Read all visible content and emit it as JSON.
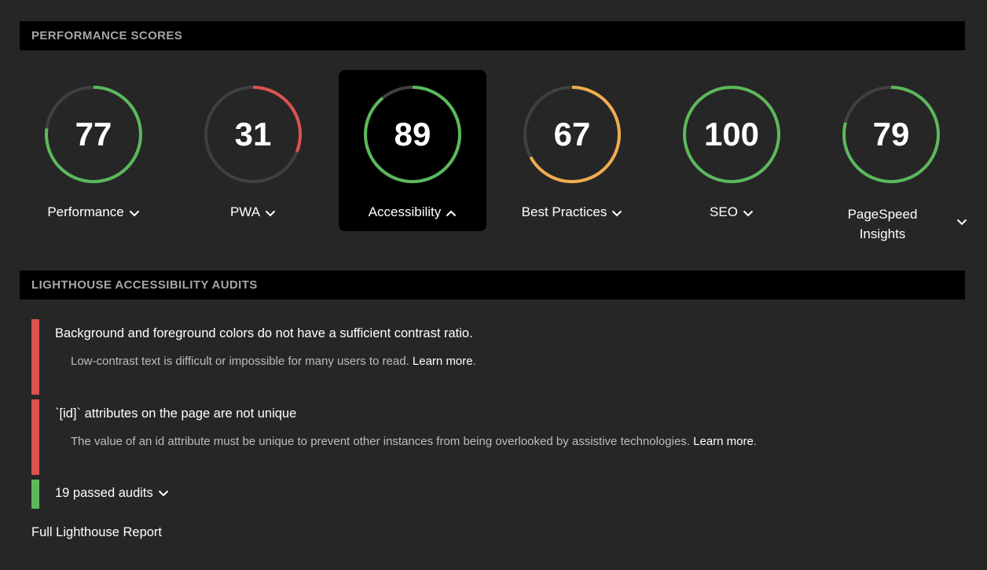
{
  "headers": {
    "scores": "PERFORMANCE SCORES",
    "audits": "LIGHTHOUSE ACCESSIBILITY AUDITS"
  },
  "colors": {
    "good": "#5cb85c",
    "average": "#f0ad4e",
    "poor": "#d9534f",
    "track": "#404040"
  },
  "scores": [
    {
      "label": "Performance",
      "value": "77",
      "score": 77,
      "status": "good",
      "chevron": "chevron-down-icon"
    },
    {
      "label": "PWA",
      "value": "31",
      "score": 31,
      "status": "poor",
      "chevron": "chevron-down-icon"
    },
    {
      "label": "Accessibility",
      "value": "89",
      "score": 89,
      "status": "good",
      "chevron": "chevron-up-icon",
      "active": true
    },
    {
      "label": "Best Practices",
      "value": "67",
      "score": 67,
      "status": "average",
      "chevron": "chevron-down-icon"
    },
    {
      "label": "SEO",
      "value": "100",
      "score": 100,
      "status": "good",
      "chevron": "chevron-down-icon"
    },
    {
      "label_line1": "PageSpeed",
      "label_line2": "Insights",
      "value": "79",
      "score": 79,
      "status": "good",
      "chevron": "chevron-down-icon"
    }
  ],
  "audits": [
    {
      "title": "Background and foreground colors do not have a sufficient contrast ratio.",
      "description": "Low-contrast text is difficult or impossible for many users to read.",
      "learn_more": "Learn more",
      "period": ".",
      "status": "poor"
    },
    {
      "title": "`[id]` attributes on the page are not unique",
      "description": "The value of an id attribute must be unique to prevent other instances from being overlooked by assistive technologies.",
      "learn_more": "Learn more",
      "period": ".",
      "status": "poor"
    }
  ],
  "passed": {
    "label": "19 passed audits",
    "status": "good"
  },
  "full_report": "Full Lighthouse Report"
}
